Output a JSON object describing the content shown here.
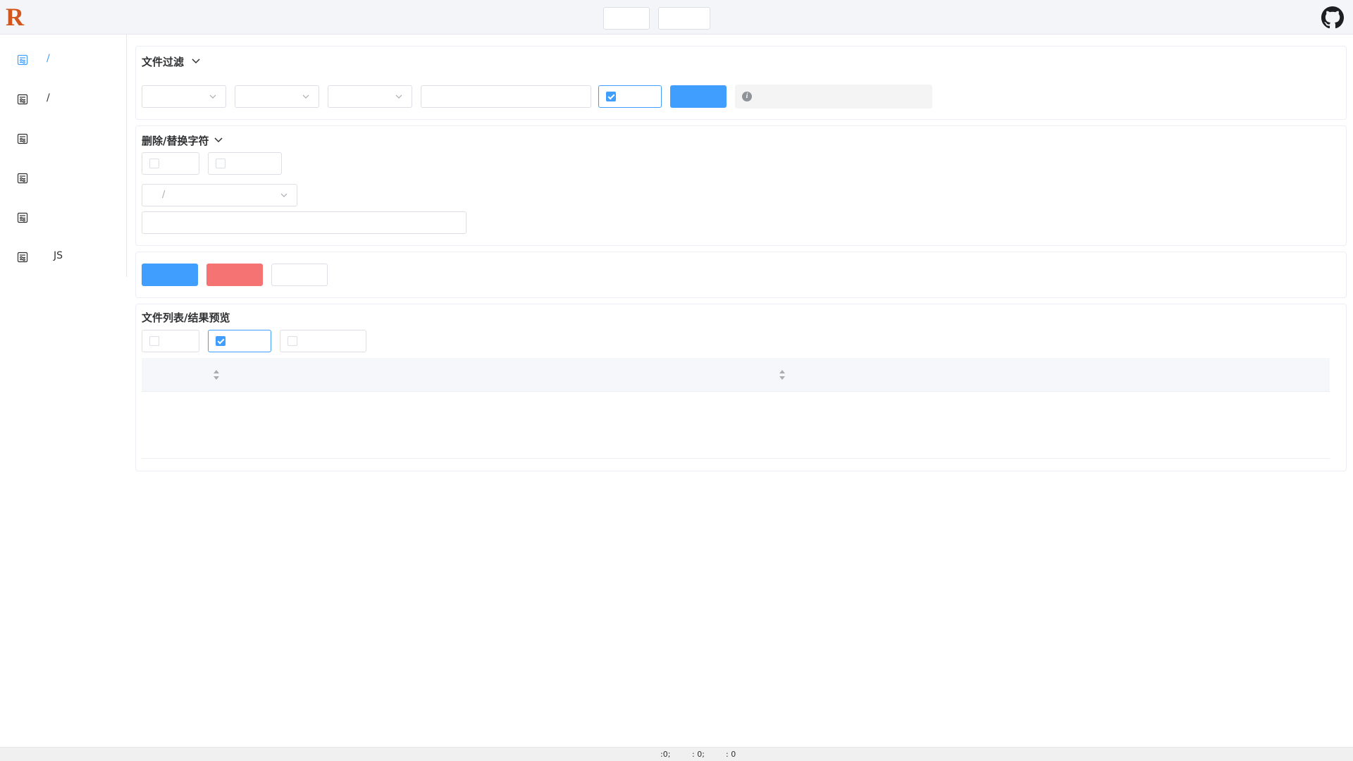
{
  "header": {
    "logo_text": "R",
    "buttons": [
      "",
      ""
    ],
    "github_icon": "github-icon"
  },
  "sidebar": {
    "items": [
      {
        "label": "/",
        "icon": "tool-icon",
        "active": true
      },
      {
        "label": "/",
        "icon": "tool-icon",
        "active": false
      },
      {
        "label": "",
        "icon": "tool-icon",
        "active": false
      },
      {
        "label": "",
        "icon": "tool-icon",
        "active": false
      },
      {
        "label": "",
        "icon": "tool-icon",
        "active": false
      },
      {
        "label": "JS",
        "icon": "tool-icon",
        "active": false
      }
    ]
  },
  "filter": {
    "title": "文件过滤",
    "select1": "",
    "select2": "",
    "select3": "",
    "input": "",
    "checkbox_checked": true,
    "apply_button": "",
    "info_text": ""
  },
  "replace": {
    "title": "删除/替换字符",
    "checkbox1": false,
    "checkbox2": false,
    "mode_select": "/",
    "input": ""
  },
  "actions": {
    "primary_button": "",
    "danger_button": "",
    "plain_button": ""
  },
  "preview": {
    "title": "文件列表/结果预览",
    "checkbox1": false,
    "checkbox2": true,
    "checkbox3": false,
    "columns": [
      "",
      ""
    ]
  },
  "footer": {
    "stat1": ":0;",
    "stat2": ": 0;",
    "stat3": ": 0"
  },
  "colors": {
    "accent": "#409eff",
    "danger": "#f56c6c",
    "logo": "#d2561d"
  }
}
